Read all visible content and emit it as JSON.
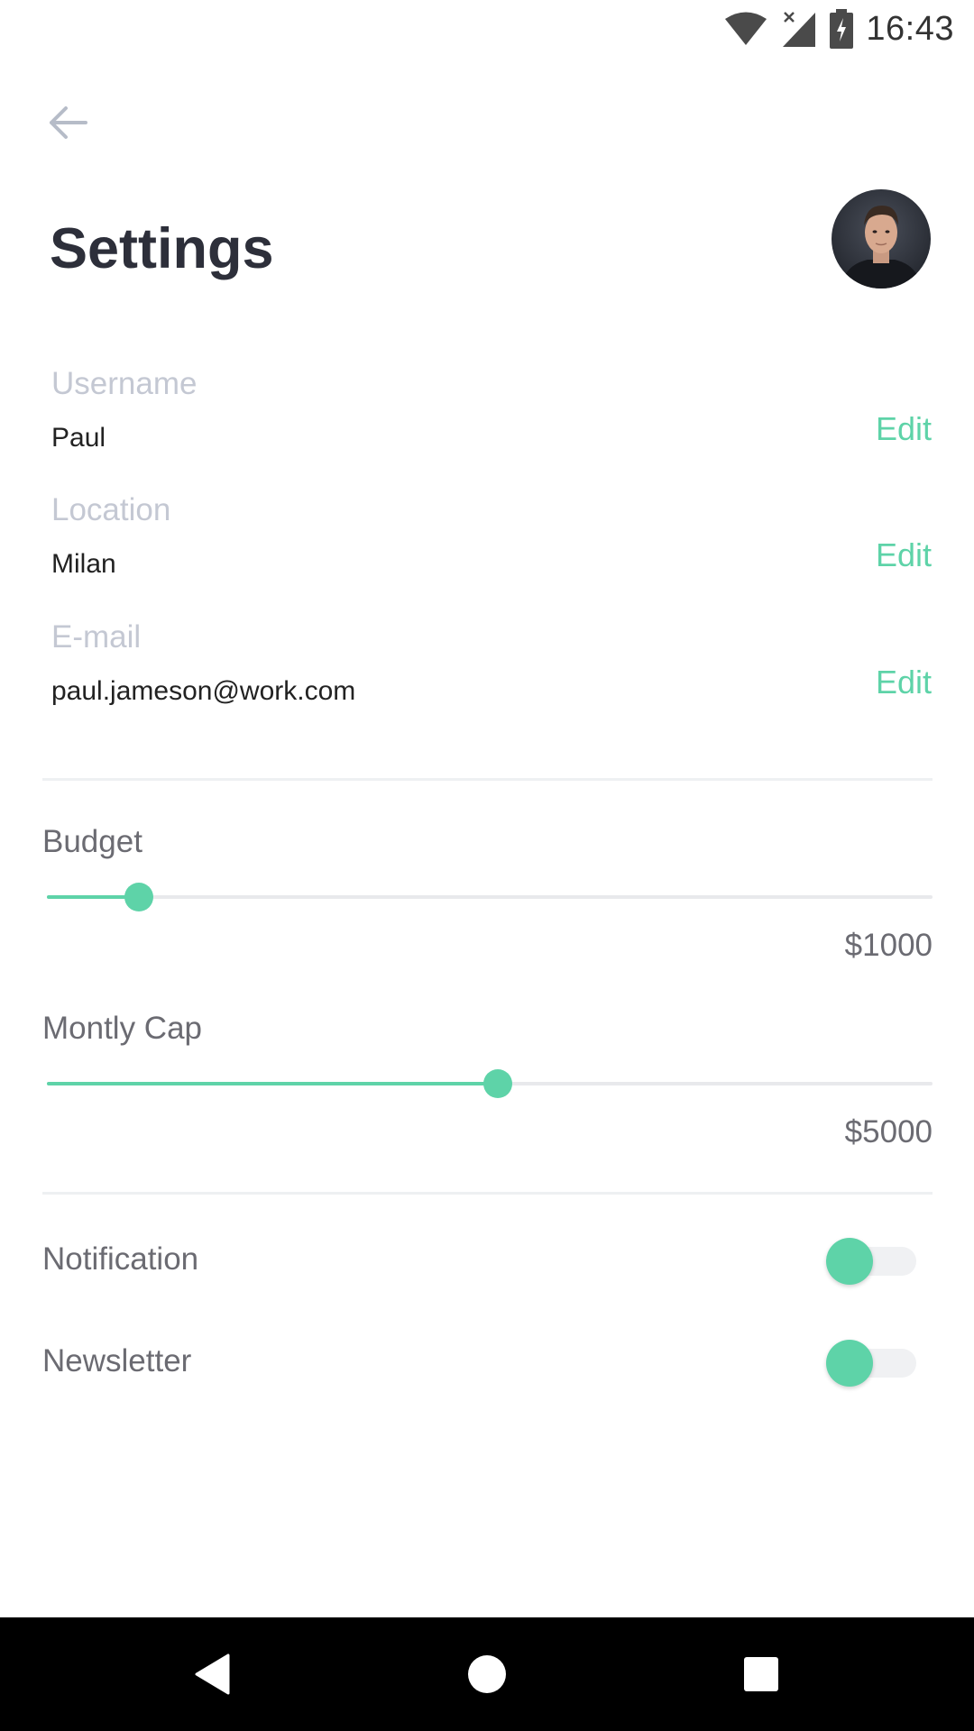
{
  "status_bar": {
    "time": "16:43",
    "icons": [
      "wifi-icon",
      "signal-no-data-icon",
      "battery-charging-icon"
    ]
  },
  "header": {
    "back_icon": "arrow-left-icon",
    "title": "Settings",
    "avatar": "profile-avatar"
  },
  "profile": {
    "edit_label": "Edit",
    "fields": [
      {
        "label": "Username",
        "value": "Paul"
      },
      {
        "label": "Location",
        "value": "Milan"
      },
      {
        "label": "E-mail",
        "value": "paul.jameson@work.com"
      }
    ]
  },
  "sliders": [
    {
      "label": "Budget",
      "value_text": "$1000",
      "fraction": 0.104
    },
    {
      "label": "Montly Cap",
      "value_text": "$5000",
      "fraction": 0.509
    }
  ],
  "toggles": [
    {
      "label": "Notification",
      "state": "off"
    },
    {
      "label": "Newsletter",
      "state": "off"
    }
  ],
  "colors": {
    "accent": "#5ed3a8",
    "label_muted": "#c4c8d3",
    "title": "#2d2f3a"
  },
  "nav_bar": {
    "icons": [
      "back-triangle-icon",
      "home-circle-icon",
      "recents-square-icon"
    ]
  }
}
